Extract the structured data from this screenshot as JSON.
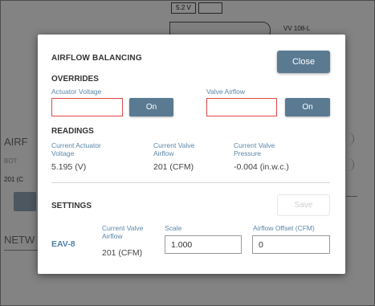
{
  "background": {
    "voltage_box": "5.2 V",
    "valve_label": "VV 108-L",
    "airflow_heading": "AIRF",
    "faint_label": "BOT",
    "row_value": "201 (C",
    "network_heading": "NETW"
  },
  "modal": {
    "title": "AIRFLOW BALANCING",
    "close_label": "Close",
    "overrides": {
      "heading": "OVERRIDES",
      "actuator_voltage_label": "Actuator Voltage",
      "actuator_voltage_value": "",
      "valve_airflow_label": "Valve Airflow",
      "valve_airflow_value": "",
      "on_label": "On"
    },
    "readings": {
      "heading": "READINGS",
      "items": [
        {
          "label_line1": "Current Actuator",
          "label_line2": "Voltage",
          "value": "5.195 (V)"
        },
        {
          "label_line1": "Current Valve",
          "label_line2": "Airflow",
          "value": "201 (CFM)"
        },
        {
          "label_line1": "Current Valve",
          "label_line2": "Pressure",
          "value": "-0.004 (in.w.c.)"
        }
      ]
    },
    "settings": {
      "heading": "SETTINGS",
      "save_label": "Save",
      "device_name": "EAV-8",
      "current_airflow_label_line1": "Current Valve",
      "current_airflow_label_line2": "Airflow",
      "current_airflow_value": "201 (CFM)",
      "scale_label": "Scale",
      "scale_value": "1.000",
      "offset_label": "Airflow Offset (CFM)",
      "offset_value": "0"
    }
  },
  "colors": {
    "button_primary": "#5a7a92",
    "label_blue": "#5b87a8",
    "error_border": "#e04848",
    "overlay": "rgba(0,0,0,0.45)"
  }
}
